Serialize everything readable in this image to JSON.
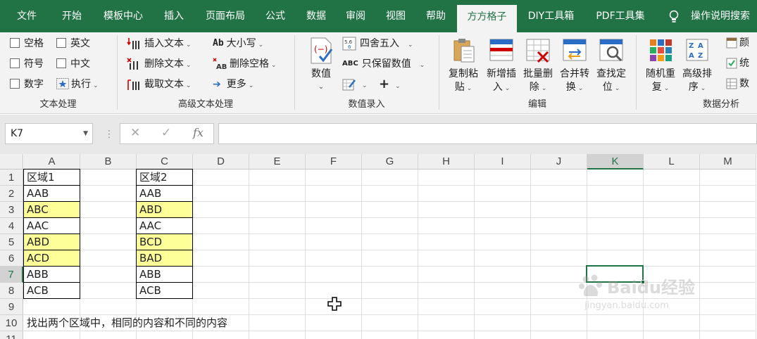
{
  "tabs": [
    "文件",
    "开始",
    "模板中心",
    "插入",
    "页面布局",
    "公式",
    "数据",
    "审阅",
    "视图",
    "帮助",
    "方方格子",
    "DIY工具箱",
    "PDF工具集"
  ],
  "active_tab": "方方格子",
  "help_label": "操作说明搜索",
  "ribbon": {
    "text_group": {
      "label": "文本处理",
      "checkboxes": [
        "空格",
        "英文",
        "符号",
        "中文",
        "数字"
      ],
      "execute": "执行"
    },
    "advanced_group": {
      "label": "高级文本处理",
      "items": [
        "插入文本",
        "删除文本",
        "截取文本",
        "大小写",
        "删除空格",
        "更多"
      ]
    },
    "numeric_group": {
      "label": "数值录入",
      "value_btn": "数值",
      "round": "四舍五入",
      "keep_numeric": "只保留数值",
      "plus": "+"
    },
    "edit_group": {
      "label": "编辑",
      "buttons": [
        {
          "l1": "复制粘",
          "l2": "贴"
        },
        {
          "l1": "新增插",
          "l2": "入"
        },
        {
          "l1": "批量删",
          "l2": "除"
        },
        {
          "l1": "合并转",
          "l2": "换"
        },
        {
          "l1": "查找定",
          "l2": "位"
        }
      ]
    },
    "analysis_group": {
      "label": "数据分析",
      "buttons": [
        {
          "l1": "随机重",
          "l2": "复"
        },
        {
          "l1": "高级排",
          "l2": "序"
        }
      ],
      "small": [
        "颜",
        "统",
        "数"
      ]
    }
  },
  "formula_bar": {
    "name_box": "K7",
    "cancel": "✕",
    "enter": "✓",
    "fx": "fx",
    "formula": ""
  },
  "sheet": {
    "columns": [
      "A",
      "B",
      "C",
      "D",
      "E",
      "F",
      "G",
      "H",
      "I",
      "J",
      "K",
      "L",
      "M"
    ],
    "rows": [
      "1",
      "2",
      "3",
      "4",
      "5",
      "6",
      "7",
      "8",
      "9",
      "10",
      "11"
    ],
    "selected_cell": "K7",
    "col_a": [
      "区域1",
      "AAB",
      "ABC",
      "AAC",
      "ABD",
      "ACD",
      "ABB",
      "ACB"
    ],
    "col_c": [
      "区域2",
      "AAB",
      "ABD",
      "AAC",
      "BCD",
      "BAD",
      "ABB",
      "ACB"
    ],
    "highlight_a": [
      false,
      false,
      true,
      false,
      true,
      true,
      false,
      false
    ],
    "highlight_c": [
      false,
      false,
      true,
      false,
      true,
      true,
      false,
      false
    ],
    "highlight_color": "#ffff99",
    "note": "找出两个区域中，相同的内容和不同的内容"
  },
  "watermark": {
    "main": "Baidu经验",
    "sub": "jingyan.baidu.com"
  }
}
